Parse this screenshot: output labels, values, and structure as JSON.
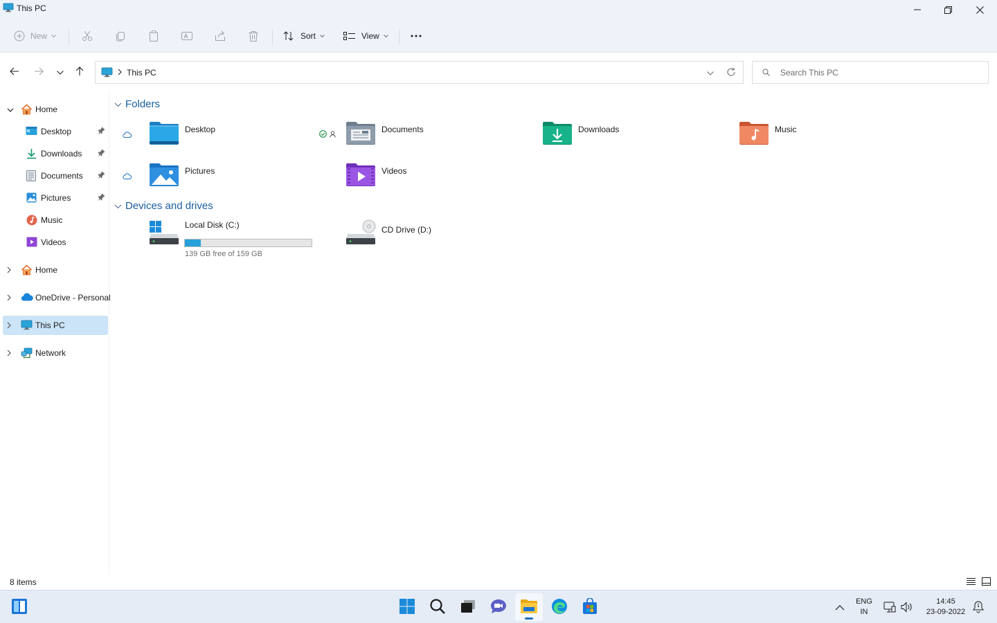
{
  "window": {
    "title": "This PC"
  },
  "toolbar": {
    "new_label": "New",
    "sort_label": "Sort",
    "view_label": "View",
    "more_label": "···"
  },
  "address": {
    "crumb": "This PC",
    "search_placeholder": "Search This PC"
  },
  "sidebar": {
    "items": [
      {
        "label": "Home",
        "icon": "home-icon"
      },
      {
        "label": "Desktop",
        "icon": "desktop-folder-icon"
      },
      {
        "label": "Downloads",
        "icon": "downloads-folder-icon"
      },
      {
        "label": "Documents",
        "icon": "documents-folder-icon"
      },
      {
        "label": "Pictures",
        "icon": "pictures-folder-icon"
      },
      {
        "label": "Music",
        "icon": "music-folder-icon"
      },
      {
        "label": "Videos",
        "icon": "videos-folder-icon"
      },
      {
        "label": "Home",
        "icon": "home-icon"
      },
      {
        "label": "OneDrive - Personal",
        "icon": "onedrive-cloud-icon"
      },
      {
        "label": "This PC",
        "icon": "computer-icon",
        "selected": true
      },
      {
        "label": "Network",
        "icon": "network-icon"
      }
    ]
  },
  "content": {
    "folders_header": "Folders",
    "folders": [
      {
        "name": "Desktop",
        "icon": "desktop-folder-icon",
        "status": "cloud"
      },
      {
        "name": "Documents",
        "icon": "documents-folder-icon",
        "status": "synced-shared"
      },
      {
        "name": "Downloads",
        "icon": "downloads-folder-icon",
        "status": ""
      },
      {
        "name": "Music",
        "icon": "music-folder-icon",
        "status": ""
      },
      {
        "name": "Pictures",
        "icon": "pictures-folder-icon",
        "status": "cloud"
      },
      {
        "name": "Videos",
        "icon": "videos-folder-icon",
        "status": ""
      }
    ],
    "drives_header": "Devices and drives",
    "drives": [
      {
        "name": "Local Disk (C:)",
        "free_text": "139 GB free of 159 GB",
        "used_fraction": 0.126
      },
      {
        "name": "CD Drive (D:)"
      }
    ]
  },
  "status": {
    "item_count": "8 items"
  },
  "taskbar": {
    "lang_1": "ENG",
    "lang_2": "IN",
    "time": "14:45",
    "date": "23-09-2022"
  },
  "colors": {
    "accent": "#1a5fa0",
    "selection": "#cce4f7",
    "drive_fill": "#26a0da"
  }
}
